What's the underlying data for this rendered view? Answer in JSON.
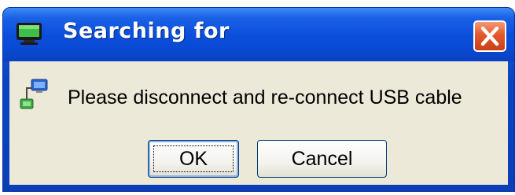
{
  "window": {
    "title": "Searching for",
    "close_icon": "close-x-icon",
    "app_icon": "monitor-icon"
  },
  "content": {
    "icon": "network-device-icon",
    "message": "Please disconnect and re-connect USB cable"
  },
  "buttons": {
    "ok_label": "OK",
    "cancel_label": "Cancel"
  },
  "colors": {
    "titlebar": "#0b4fdc",
    "close_button": "#e4582c",
    "client_background": "#ece9d8"
  }
}
